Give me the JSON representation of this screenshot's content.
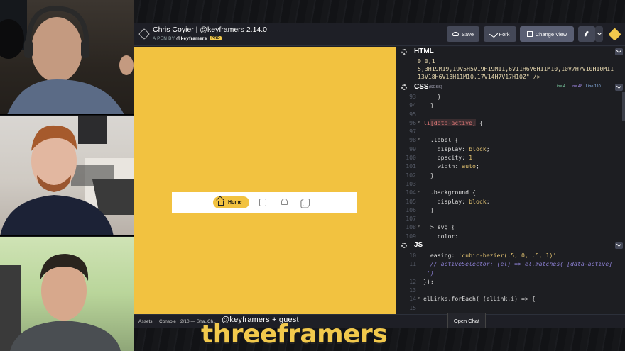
{
  "pen": {
    "title": "Chris Coyier | @keyframers 2.14.0",
    "by_prefix": "A PEN BY",
    "author": "@keyframers",
    "pro_badge": "PRO"
  },
  "toolbar": {
    "save_label": "Save",
    "fork_label": "Fork",
    "change_view_label": "Change View"
  },
  "preview": {
    "nav_active_label": "Home"
  },
  "html_panel": {
    "name": "HTML",
    "lines": [
      "0 0,1",
      "5,3H19M19,19V5H5V19H19M11,6V11H6V6H11M10,10V7H7V10H10M11",
      "13V18H6V13H11M10,17V14H7V17H10Z\" />"
    ]
  },
  "css_panel": {
    "name": "CSS",
    "preprocessor": "(SCSS)",
    "line_stats": [
      "Line 4",
      "Line 48",
      "Line 110"
    ],
    "rows": [
      {
        "n": "93",
        "fold": "",
        "parts": [
          {
            "c": "c-sel",
            "t": "    }"
          }
        ]
      },
      {
        "n": "94",
        "fold": "",
        "parts": [
          {
            "c": "c-sel",
            "t": "  }"
          }
        ]
      },
      {
        "n": "95",
        "fold": "",
        "parts": [
          {
            "c": "",
            "t": ""
          }
        ]
      },
      {
        "n": "96",
        "fold": "▾",
        "parts": [
          {
            "c": "c-red",
            "t": "li"
          },
          {
            "c": "c-attr",
            "t": "[data-active]"
          },
          {
            "c": "c-sel",
            "t": " {"
          }
        ]
      },
      {
        "n": "97",
        "fold": "",
        "parts": [
          {
            "c": "",
            "t": ""
          }
        ]
      },
      {
        "n": "98",
        "fold": "▾",
        "parts": [
          {
            "c": "c-sel",
            "t": "  .label {"
          }
        ]
      },
      {
        "n": "99",
        "fold": "",
        "parts": [
          {
            "c": "c-key",
            "t": "    display: "
          },
          {
            "c": "c-val",
            "t": "block"
          },
          {
            "c": "c-key",
            "t": ";"
          }
        ]
      },
      {
        "n": "100",
        "fold": "",
        "parts": [
          {
            "c": "c-key",
            "t": "    opacity: "
          },
          {
            "c": "c-val",
            "t": "1"
          },
          {
            "c": "c-key",
            "t": ";"
          }
        ]
      },
      {
        "n": "101",
        "fold": "",
        "parts": [
          {
            "c": "c-key",
            "t": "    width: "
          },
          {
            "c": "c-val",
            "t": "auto"
          },
          {
            "c": "c-key",
            "t": ";"
          }
        ]
      },
      {
        "n": "102",
        "fold": "",
        "parts": [
          {
            "c": "c-sel",
            "t": "  }"
          }
        ]
      },
      {
        "n": "103",
        "fold": "",
        "parts": [
          {
            "c": "",
            "t": ""
          }
        ]
      },
      {
        "n": "104",
        "fold": "▾",
        "parts": [
          {
            "c": "c-sel",
            "t": "  .background {"
          }
        ]
      },
      {
        "n": "105",
        "fold": "",
        "parts": [
          {
            "c": "c-key",
            "t": "    display: "
          },
          {
            "c": "c-val",
            "t": "block"
          },
          {
            "c": "c-key",
            "t": ";"
          }
        ]
      },
      {
        "n": "106",
        "fold": "",
        "parts": [
          {
            "c": "c-sel",
            "t": "  }"
          }
        ]
      },
      {
        "n": "107",
        "fold": "",
        "parts": [
          {
            "c": "",
            "t": ""
          }
        ]
      },
      {
        "n": "108",
        "fold": "▾",
        "parts": [
          {
            "c": "c-sel",
            "t": "  > svg {"
          }
        ]
      },
      {
        "n": "109",
        "fold": "",
        "parts": [
          {
            "c": "c-key",
            "t": "    color: "
          }
        ]
      }
    ]
  },
  "js_panel": {
    "name": "JS",
    "rows": [
      {
        "n": "10",
        "fold": "",
        "parts": [
          {
            "c": "c-key",
            "t": "  easing: "
          },
          {
            "c": "c-str",
            "t": "'cubic-bezier(.5, 0, .5, 1)'"
          }
        ]
      },
      {
        "n": "11",
        "fold": "",
        "parts": [
          {
            "c": "c-com",
            "t": "  // activeSelector: (el) => el.matches('[data-active]"
          }
        ]
      },
      {
        "n": "",
        "fold": "",
        "parts": [
          {
            "c": "c-com",
            "t": "'')"
          }
        ]
      },
      {
        "n": "12",
        "fold": "",
        "parts": [
          {
            "c": "c-key",
            "t": "});"
          }
        ]
      },
      {
        "n": "13",
        "fold": "",
        "parts": [
          {
            "c": "",
            "t": ""
          }
        ]
      },
      {
        "n": "14",
        "fold": "▾",
        "parts": [
          {
            "c": "c-key",
            "t": "elLinks.forEach( (elLink,i) => {"
          }
        ]
      },
      {
        "n": "15",
        "fold": "",
        "parts": [
          {
            "c": "",
            "t": ""
          }
        ]
      }
    ]
  },
  "bottombar": {
    "assets_label": "Assets",
    "console_label": "Console",
    "status_text": "2/10 — Sha..Ch..",
    "open_chat_label": "Open Chat"
  },
  "brand": {
    "subtitle": "@keyframers + guest",
    "name": "threeframers"
  },
  "colors": {
    "preview_bg": "#f2c240",
    "accent": "#f2c94c",
    "editor_bg": "#1d1e22",
    "line_stat_1": "#7fd1a6",
    "line_stat_2": "#a98ff0",
    "line_stat_3": "#8fb9f0"
  }
}
